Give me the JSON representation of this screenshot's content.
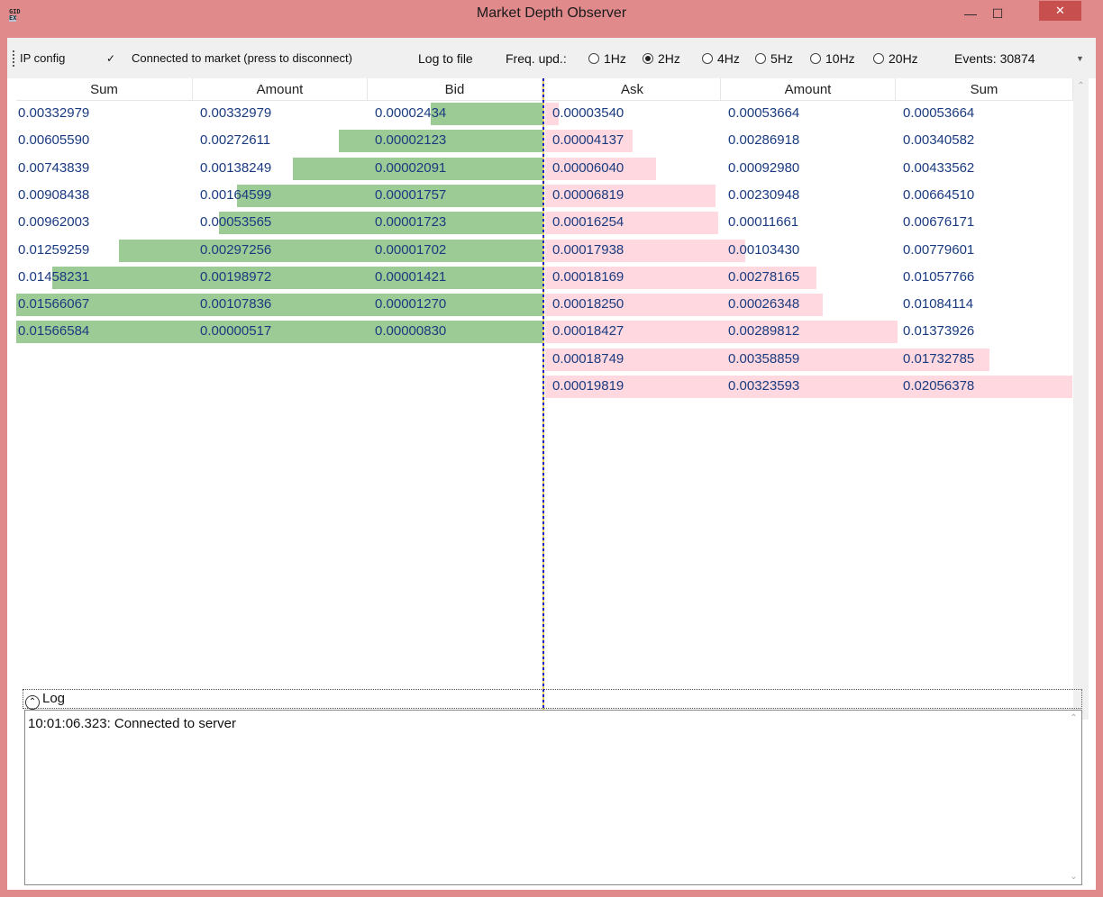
{
  "window": {
    "title": "Market Depth Observer",
    "icon_glyphs": [
      "GID",
      "EX"
    ],
    "colors": {
      "frame": "#e08a8c",
      "close_button": "#c7504f",
      "bid_bar": "#9dcb96",
      "ask_bar": "#ffd9df",
      "cell_text": "#1a3a80"
    }
  },
  "toolbar": {
    "ip_config": "IP config",
    "connect_toggle_icon": "check-icon",
    "connected_label": "Connected to market (press to disconnect)",
    "log_to_file": "Log to file",
    "freq_label": "Freq. upd.:",
    "freq_options": [
      "1Hz",
      "2Hz",
      "4Hz",
      "5Hz",
      "10Hz",
      "20Hz"
    ],
    "freq_selected": "2Hz",
    "events": "Events: 30874"
  },
  "grid": {
    "bid_headers": [
      "Sum",
      "Amount",
      "Bid"
    ],
    "ask_headers": [
      "Ask",
      "Amount",
      "Sum"
    ],
    "bids": [
      {
        "sum": "0.00332979",
        "amount": "0.00332979",
        "price": "0.00002434",
        "depth": 0.212
      },
      {
        "sum": "0.00605590",
        "amount": "0.00272611",
        "price": "0.00002123",
        "depth": 0.387
      },
      {
        "sum": "0.00743839",
        "amount": "0.00138249",
        "price": "0.00002091",
        "depth": 0.475
      },
      {
        "sum": "0.00908438",
        "amount": "0.00164599",
        "price": "0.00001757",
        "depth": 0.58
      },
      {
        "sum": "0.00962003",
        "amount": "0.00053565",
        "price": "0.00001723",
        "depth": 0.614
      },
      {
        "sum": "0.01259259",
        "amount": "0.00297256",
        "price": "0.00001702",
        "depth": 0.804
      },
      {
        "sum": "0.01458231",
        "amount": "0.00198972",
        "price": "0.00001421",
        "depth": 0.931
      },
      {
        "sum": "0.01566067",
        "amount": "0.00107836",
        "price": "0.00001270",
        "depth": 1.0
      },
      {
        "sum": "0.01566584",
        "amount": "0.00000517",
        "price": "0.00000830",
        "depth": 1.0
      }
    ],
    "asks": [
      {
        "price": "0.00003540",
        "amount": "0.00053664",
        "sum": "0.00053664",
        "depth": 0.026
      },
      {
        "price": "0.00004137",
        "amount": "0.00286918",
        "sum": "0.00340582",
        "depth": 0.166
      },
      {
        "price": "0.00006040",
        "amount": "0.00092980",
        "sum": "0.00433562",
        "depth": 0.211
      },
      {
        "price": "0.00006819",
        "amount": "0.00230948",
        "sum": "0.00664510",
        "depth": 0.323
      },
      {
        "price": "0.00016254",
        "amount": "0.00011661",
        "sum": "0.00676171",
        "depth": 0.329
      },
      {
        "price": "0.00017938",
        "amount": "0.00103430",
        "sum": "0.00779601",
        "depth": 0.379
      },
      {
        "price": "0.00018169",
        "amount": "0.00278165",
        "sum": "0.01057766",
        "depth": 0.514
      },
      {
        "price": "0.00018250",
        "amount": "0.00026348",
        "sum": "0.01084114",
        "depth": 0.527
      },
      {
        "price": "0.00018427",
        "amount": "0.00289812",
        "sum": "0.01373926",
        "depth": 0.668
      },
      {
        "price": "0.00018749",
        "amount": "0.00358859",
        "sum": "0.01732785",
        "depth": 0.843
      },
      {
        "price": "0.00019819",
        "amount": "0.00323593",
        "sum": "0.02056378",
        "depth": 1.0
      }
    ]
  },
  "log": {
    "title": "Log",
    "lines": [
      "10:01:06.323: Connected to server"
    ]
  }
}
